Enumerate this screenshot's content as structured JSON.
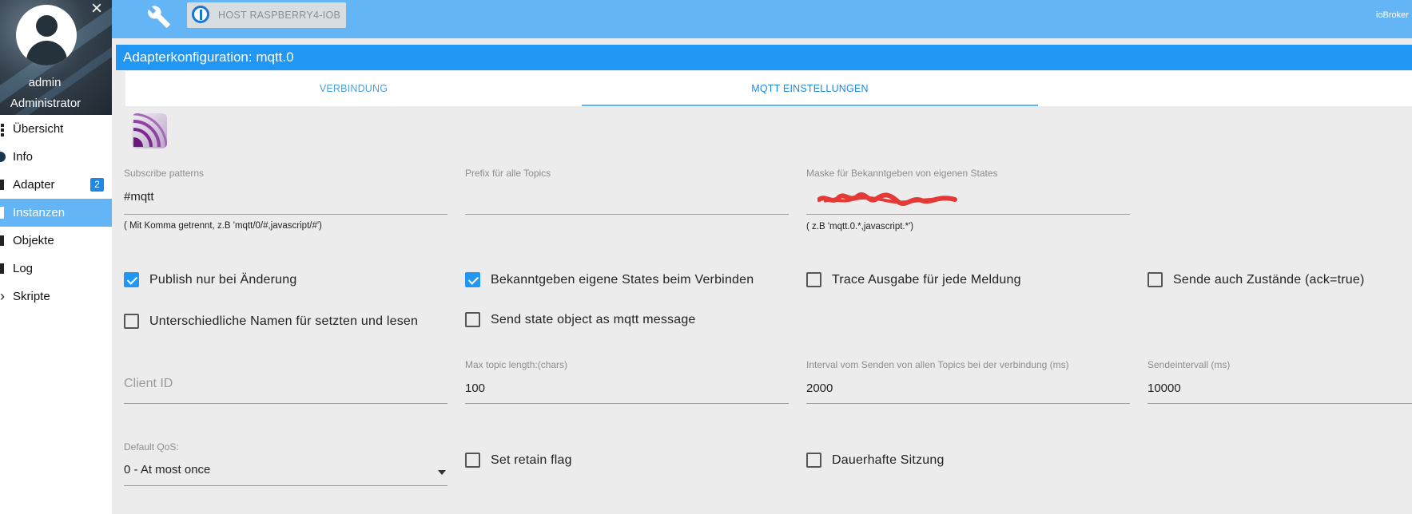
{
  "sidebar": {
    "user_name": "admin",
    "user_role": "Administrator",
    "close_icon": "×",
    "items": [
      {
        "label": "Übersicht",
        "icon": "dots-icon"
      },
      {
        "label": "Info",
        "icon": "info-icon"
      },
      {
        "label": "Adapter",
        "icon": "adapter-icon",
        "badge": "2"
      },
      {
        "label": "Instanzen",
        "icon": "instances-icon",
        "active": true
      },
      {
        "label": "Objekte",
        "icon": "objects-icon"
      },
      {
        "label": "Log",
        "icon": "log-icon"
      },
      {
        "label": "Skripte",
        "icon": "chevron-right-icon"
      }
    ]
  },
  "topbar": {
    "host_label": "HOST RASPBERRY4-IOB",
    "brand": "ioBroker"
  },
  "main": {
    "title": "Adapterkonfiguration: mqtt.0",
    "tabs": [
      {
        "label": "VERBINDUNG",
        "active": false
      },
      {
        "label": "MQTT EINSTELLUNGEN",
        "active": true
      }
    ]
  },
  "fields": {
    "subscribe": {
      "label": "Subscribe patterns",
      "value": "#mqtt",
      "help": "( Mit Komma getrennt, z.B 'mqtt/0/#,javascript/#')"
    },
    "prefix": {
      "label": "Prefix für alle Topics",
      "value": ""
    },
    "mask": {
      "label": "Maske für Bekanntgeben von eigenen States",
      "help": "( z.B 'mqtt.0.*,javascript.*')"
    },
    "client_id": {
      "placeholder": "Client ID"
    },
    "max_topic": {
      "label": "Max topic length:(chars)",
      "value": "100"
    },
    "interval_all": {
      "label": "Interval vom Senden von allen Topics bei der verbindung (ms)",
      "value": "2000"
    },
    "send_interval": {
      "label": "Sendeintervall (ms)",
      "value": "10000"
    },
    "qos": {
      "label": "Default QoS:",
      "value": "0 - At most once"
    }
  },
  "checkboxes": {
    "publish_change": {
      "label": "Publish nur bei Änderung",
      "checked": true
    },
    "announce_own": {
      "label": "Bekanntgeben eigene States beim Verbinden",
      "checked": true
    },
    "trace": {
      "label": "Trace Ausgabe für jede Meldung",
      "checked": false
    },
    "send_ack": {
      "label": "Sende auch Zustände (ack=true)",
      "checked": false
    },
    "different_names": {
      "label": "Unterschiedliche Namen für setzten und lesen",
      "checked": false
    },
    "state_object": {
      "label": "Send state object as mqtt message",
      "checked": false
    },
    "retain": {
      "label": "Set retain flag",
      "checked": false
    },
    "persistent": {
      "label": "Dauerhafte Sitzung",
      "checked": false
    }
  },
  "colors": {
    "topbar": "#64b5f6",
    "title_bar": "#2196f3",
    "active_nav": "#64b5f6",
    "checkbox_checked": "#2196f3",
    "redaction": "#e53935"
  }
}
